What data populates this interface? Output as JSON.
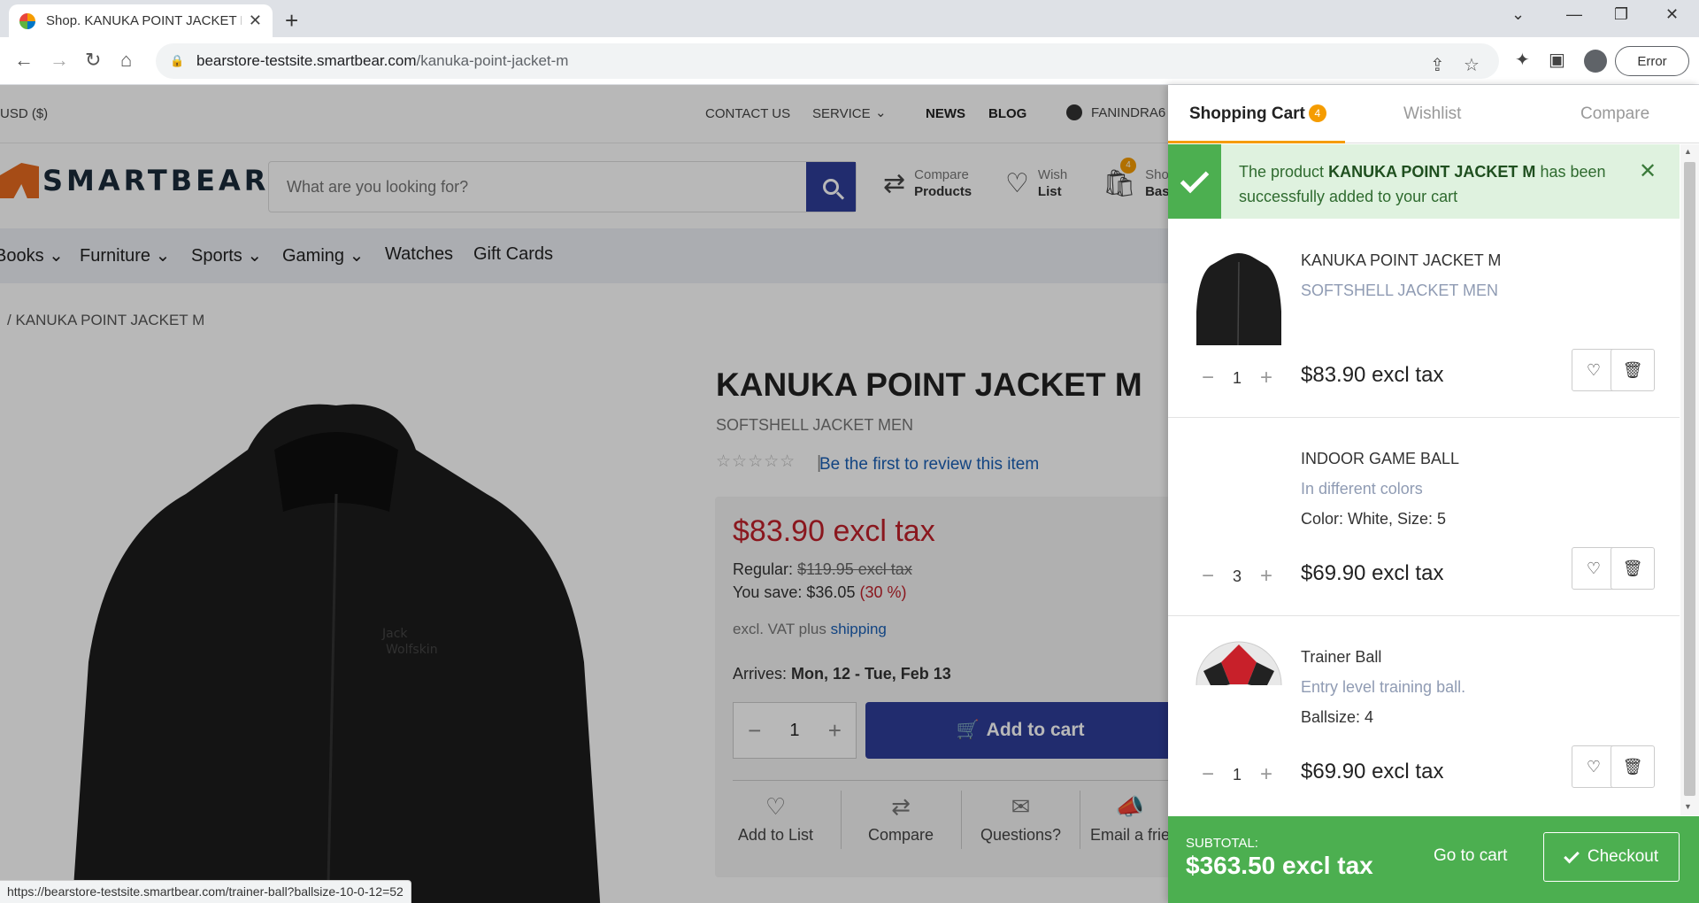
{
  "browser": {
    "tab_title": "Shop. KANUKA POINT JACKET M",
    "url_host": "bearstore-testsite.smartbear.com",
    "url_path": "/kanuka-point-jacket-m",
    "error_chip": "Error",
    "status_url": "https://bearstore-testsite.smartbear.com/trainer-ball?ballsize-10-0-12=52"
  },
  "topbar": {
    "currency": "USD  ($)",
    "links": [
      "CONTACT US",
      "SERVICE",
      "NEWS",
      "BLOG"
    ],
    "account": "FANINDRA6"
  },
  "header": {
    "logo_text": "SMARTBEAR",
    "search_placeholder": "What are you looking for?",
    "compare_top": "Compare",
    "compare_bottom": "Products",
    "wish_top": "Wish",
    "wish_bottom": "List",
    "basket_top": "Shop",
    "basket_bottom": "Bask",
    "basket_count": "4"
  },
  "catnav": [
    "Books",
    "Furniture",
    "Sports",
    "Gaming",
    "Watches",
    "Gift Cards"
  ],
  "breadcrumb": "/   KANUKA POINT JACKET M",
  "product": {
    "title": "KANUKA POINT JACKET M",
    "subtitle": "SOFTSHELL JACKET MEN",
    "review_link": "Be the first to review this item",
    "price": "$83.90 excl tax",
    "regular_label": "Regular:",
    "regular_price": "$119.95 excl tax",
    "save_label": "You save: $36.05",
    "save_pct": "(30 %)",
    "vat_text": "excl. VAT plus",
    "vat_link": "shipping",
    "arrives_label": "Arrives:",
    "arrives_value": "Mon, 12 - Tue, Feb 13",
    "qty": "1",
    "add_to_cart": "Add to cart",
    "actions": [
      "Add to List",
      "Compare",
      "Questions?",
      "Email a frie"
    ]
  },
  "drawer": {
    "tabs": [
      "Shopping Cart",
      "Wishlist",
      "Compare"
    ],
    "cart_count": "4",
    "alert_pre": "The product",
    "alert_product": "KANUKA POINT JACKET M",
    "alert_post": "has been successfully added to your cart",
    "items": [
      {
        "name": "KANUKA POINT JACKET M",
        "desc": "SOFTSHELL JACKET MEN",
        "attr": "",
        "qty": "1",
        "price": "$83.90 excl tax"
      },
      {
        "name": "INDOOR GAME BALL",
        "desc": "In different colors",
        "attr": "Color: White, Size: 5",
        "qty": "3",
        "price": "$69.90 excl tax"
      },
      {
        "name": "Trainer Ball",
        "desc": "Entry level training ball.",
        "attr": "Ballsize: 4",
        "qty": "1",
        "price": "$69.90 excl tax"
      }
    ],
    "subtotal_label": "SUBTOTAL:",
    "subtotal_value": "$363.50 excl tax",
    "go_to_cart": "Go to cart",
    "checkout": "Checkout"
  }
}
